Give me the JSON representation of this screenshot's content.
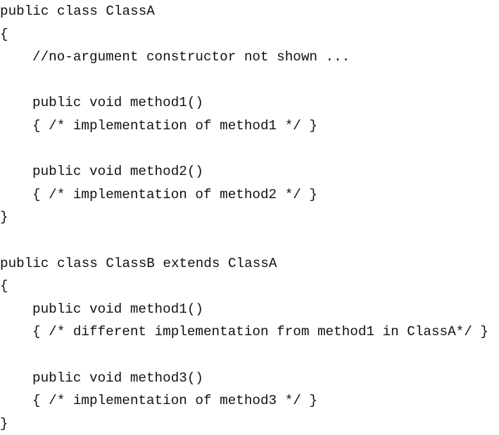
{
  "code_lines": [
    {
      "text": "public class ClassA",
      "indent": 0
    },
    {
      "text": "{",
      "indent": 0
    },
    {
      "text": "//no-argument constructor not shown ...",
      "indent": 1
    },
    {
      "text": "",
      "indent": 0
    },
    {
      "text": "public void method1()",
      "indent": 1
    },
    {
      "text": "{ /* implementation of method1 */ }",
      "indent": 1
    },
    {
      "text": "",
      "indent": 0
    },
    {
      "text": "public void method2()",
      "indent": 1
    },
    {
      "text": "{ /* implementation of method2 */ }",
      "indent": 1
    },
    {
      "text": "}",
      "indent": 0
    },
    {
      "text": "",
      "indent": 0
    },
    {
      "text": "public class ClassB extends ClassA",
      "indent": 0
    },
    {
      "text": "{",
      "indent": 0
    },
    {
      "text": "public void method1()",
      "indent": 1
    },
    {
      "text": "{ /* different implementation from method1 in ClassA*/ }",
      "indent": 1
    },
    {
      "text": "",
      "indent": 0
    },
    {
      "text": "public void method3()",
      "indent": 1
    },
    {
      "text": "{ /* implementation of method3 */ }",
      "indent": 1
    },
    {
      "text": "}",
      "indent": 0
    }
  ]
}
